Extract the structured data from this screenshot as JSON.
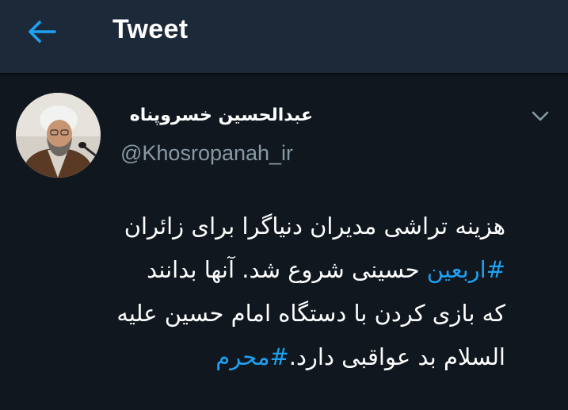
{
  "header": {
    "title": "Tweet",
    "back_icon": "arrow-left-icon",
    "accent_color": "#1da1f2",
    "background_color": "#1c2938"
  },
  "user": {
    "display_name": "عبدالحسین خسروپناه",
    "handle": "@Khosropanah_ir",
    "avatar_icon": "profile-photo",
    "menu_icon": "chevron-down-icon"
  },
  "tweet": {
    "line1": "هزینه تراشی مدیران دنیاگرا برای زائران",
    "line2_hashtag": "#اربعین",
    "line2_text": " حسینی شروع شد. آنها بدانند",
    "line3": "که بازی کردن با دستگاه امام حسین علیه",
    "line4_text": "السلام بد عواقبی دارد.",
    "line4_hashtag": "#محرم",
    "text_color": "#ffffff",
    "hashtag_color": "#1da1f2"
  },
  "background_color": "#10171e"
}
